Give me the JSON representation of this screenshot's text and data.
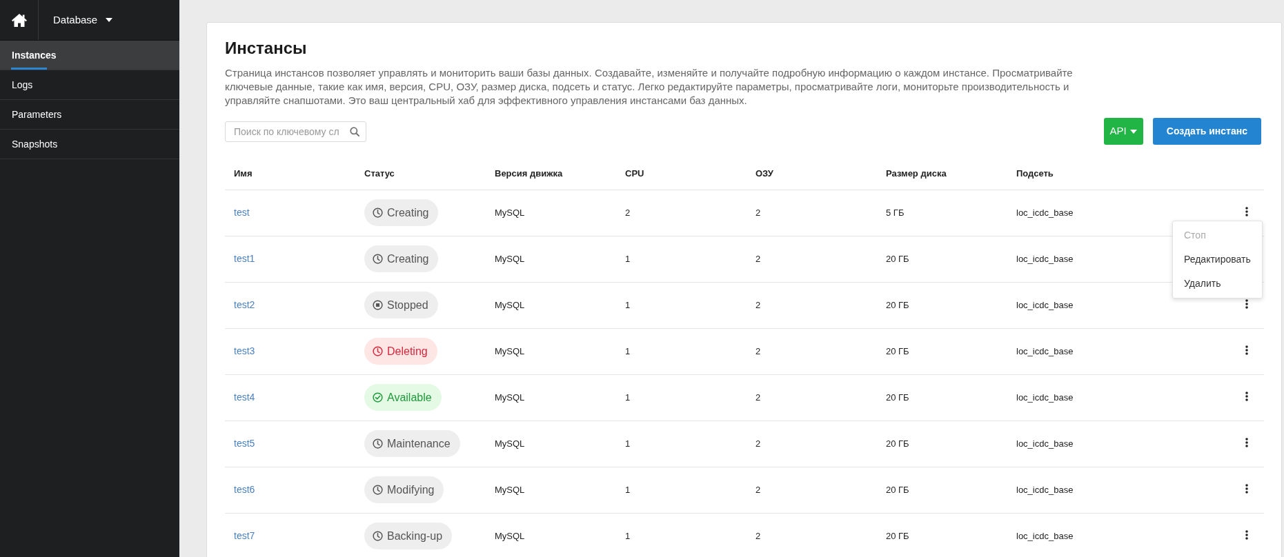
{
  "sidebar": {
    "app_menu": {
      "label": "Database"
    },
    "items": [
      {
        "label": "Instances",
        "selected": true
      },
      {
        "label": "Logs",
        "selected": false
      },
      {
        "label": "Parameters",
        "selected": false
      },
      {
        "label": "Snapshots",
        "selected": false
      }
    ]
  },
  "page": {
    "title": "Инстансы",
    "description": "Страница инстансов позволяет управлять и мониторить ваши базы данных. Создавайте, изменяйте и получайте подробную информацию о каждом инстансе. Просматривайте ключевые данные, такие как имя, версия, CPU, ОЗУ, размер диска, подсеть и статус. Легко редактируйте параметры, просматривайте логи, мониторьте производительность и управляйте снапшотами. Это ваш центральный хаб для эффективного управления инстансами баз данных.",
    "search": {
      "placeholder": "Поиск по ключевому сл"
    },
    "buttons": [
      {
        "label": "API",
        "kind": "dropdown"
      },
      {
        "label": "Создать инстанс",
        "kind": "primary"
      }
    ]
  },
  "table": {
    "columns": [
      "Имя",
      "Статус",
      "Версия движка",
      "CPU",
      "ОЗУ",
      "Размер диска",
      "Подсеть"
    ],
    "rows": [
      {
        "name": "test",
        "status": {
          "label": "Creating",
          "kind": "pending"
        },
        "engine": "MySQL",
        "cpu": "2",
        "ram": "2",
        "disk": "5 ГБ",
        "subnet": "loc_icdc_base",
        "actions_menu": {
          "items": [
            {
              "label": "Стоп",
              "disabled": true
            },
            {
              "label": "Редактировать",
              "disabled": false
            },
            {
              "label": "Удалить",
              "disabled": false
            }
          ]
        }
      },
      {
        "name": "test1",
        "status": {
          "label": "Creating",
          "kind": "pending"
        },
        "engine": "MySQL",
        "cpu": "1",
        "ram": "2",
        "disk": "20 ГБ",
        "subnet": "loc_icdc_base"
      },
      {
        "name": "test2",
        "status": {
          "label": "Stopped",
          "kind": "stopped"
        },
        "engine": "MySQL",
        "cpu": "1",
        "ram": "2",
        "disk": "20 ГБ",
        "subnet": "loc_icdc_base"
      },
      {
        "name": "test3",
        "status": {
          "label": "Deleting",
          "kind": "deleting"
        },
        "engine": "MySQL",
        "cpu": "1",
        "ram": "2",
        "disk": "20 ГБ",
        "subnet": "loc_icdc_base"
      },
      {
        "name": "test4",
        "status": {
          "label": "Available",
          "kind": "available"
        },
        "engine": "MySQL",
        "cpu": "1",
        "ram": "2",
        "disk": "20 ГБ",
        "subnet": "loc_icdc_base"
      },
      {
        "name": "test5",
        "status": {
          "label": "Maintenance",
          "kind": "pending"
        },
        "engine": "MySQL",
        "cpu": "1",
        "ram": "2",
        "disk": "20 ГБ",
        "subnet": "loc_icdc_base"
      },
      {
        "name": "test6",
        "status": {
          "label": "Modifying",
          "kind": "pending"
        },
        "engine": "MySQL",
        "cpu": "1",
        "ram": "2",
        "disk": "20 ГБ",
        "subnet": "loc_icdc_base"
      },
      {
        "name": "test7",
        "status": {
          "label": "Backing-up",
          "kind": "pending"
        },
        "engine": "MySQL",
        "cpu": "1",
        "ram": "2",
        "disk": "20 ГБ",
        "subnet": "loc_icdc_base"
      }
    ]
  }
}
